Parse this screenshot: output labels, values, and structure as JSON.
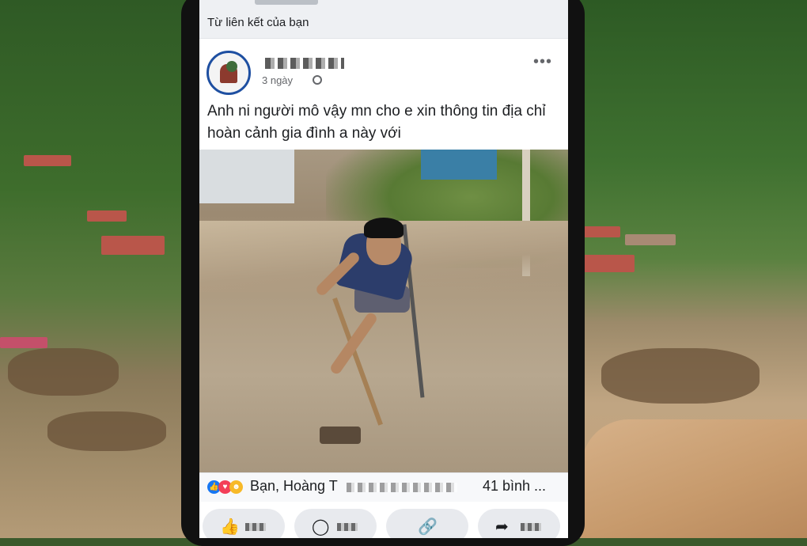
{
  "feed_header": {
    "link_label": "Từ liên kết của bạn"
  },
  "post": {
    "time": "3 ngày",
    "more_icon": "ellipsis-icon",
    "audience_icon": "globe-icon",
    "text": "Anh ni người mô vậy mn cho e xin thông tin địa chỉ hoàn cảnh gia đình a này với"
  },
  "reactions": {
    "icons": [
      "like-icon",
      "love-icon",
      "care-icon"
    ],
    "names": "Bạn, Hoàng T",
    "count": "41 bình ..."
  },
  "actions": [
    {
      "icon": "like-icon"
    },
    {
      "icon": "comment-icon"
    },
    {
      "icon": "link-icon"
    },
    {
      "icon": "share-icon"
    }
  ],
  "colors": {
    "facebook_blue": "#1877f2",
    "text": "#1c1e21",
    "secondary_text": "#65676b"
  }
}
